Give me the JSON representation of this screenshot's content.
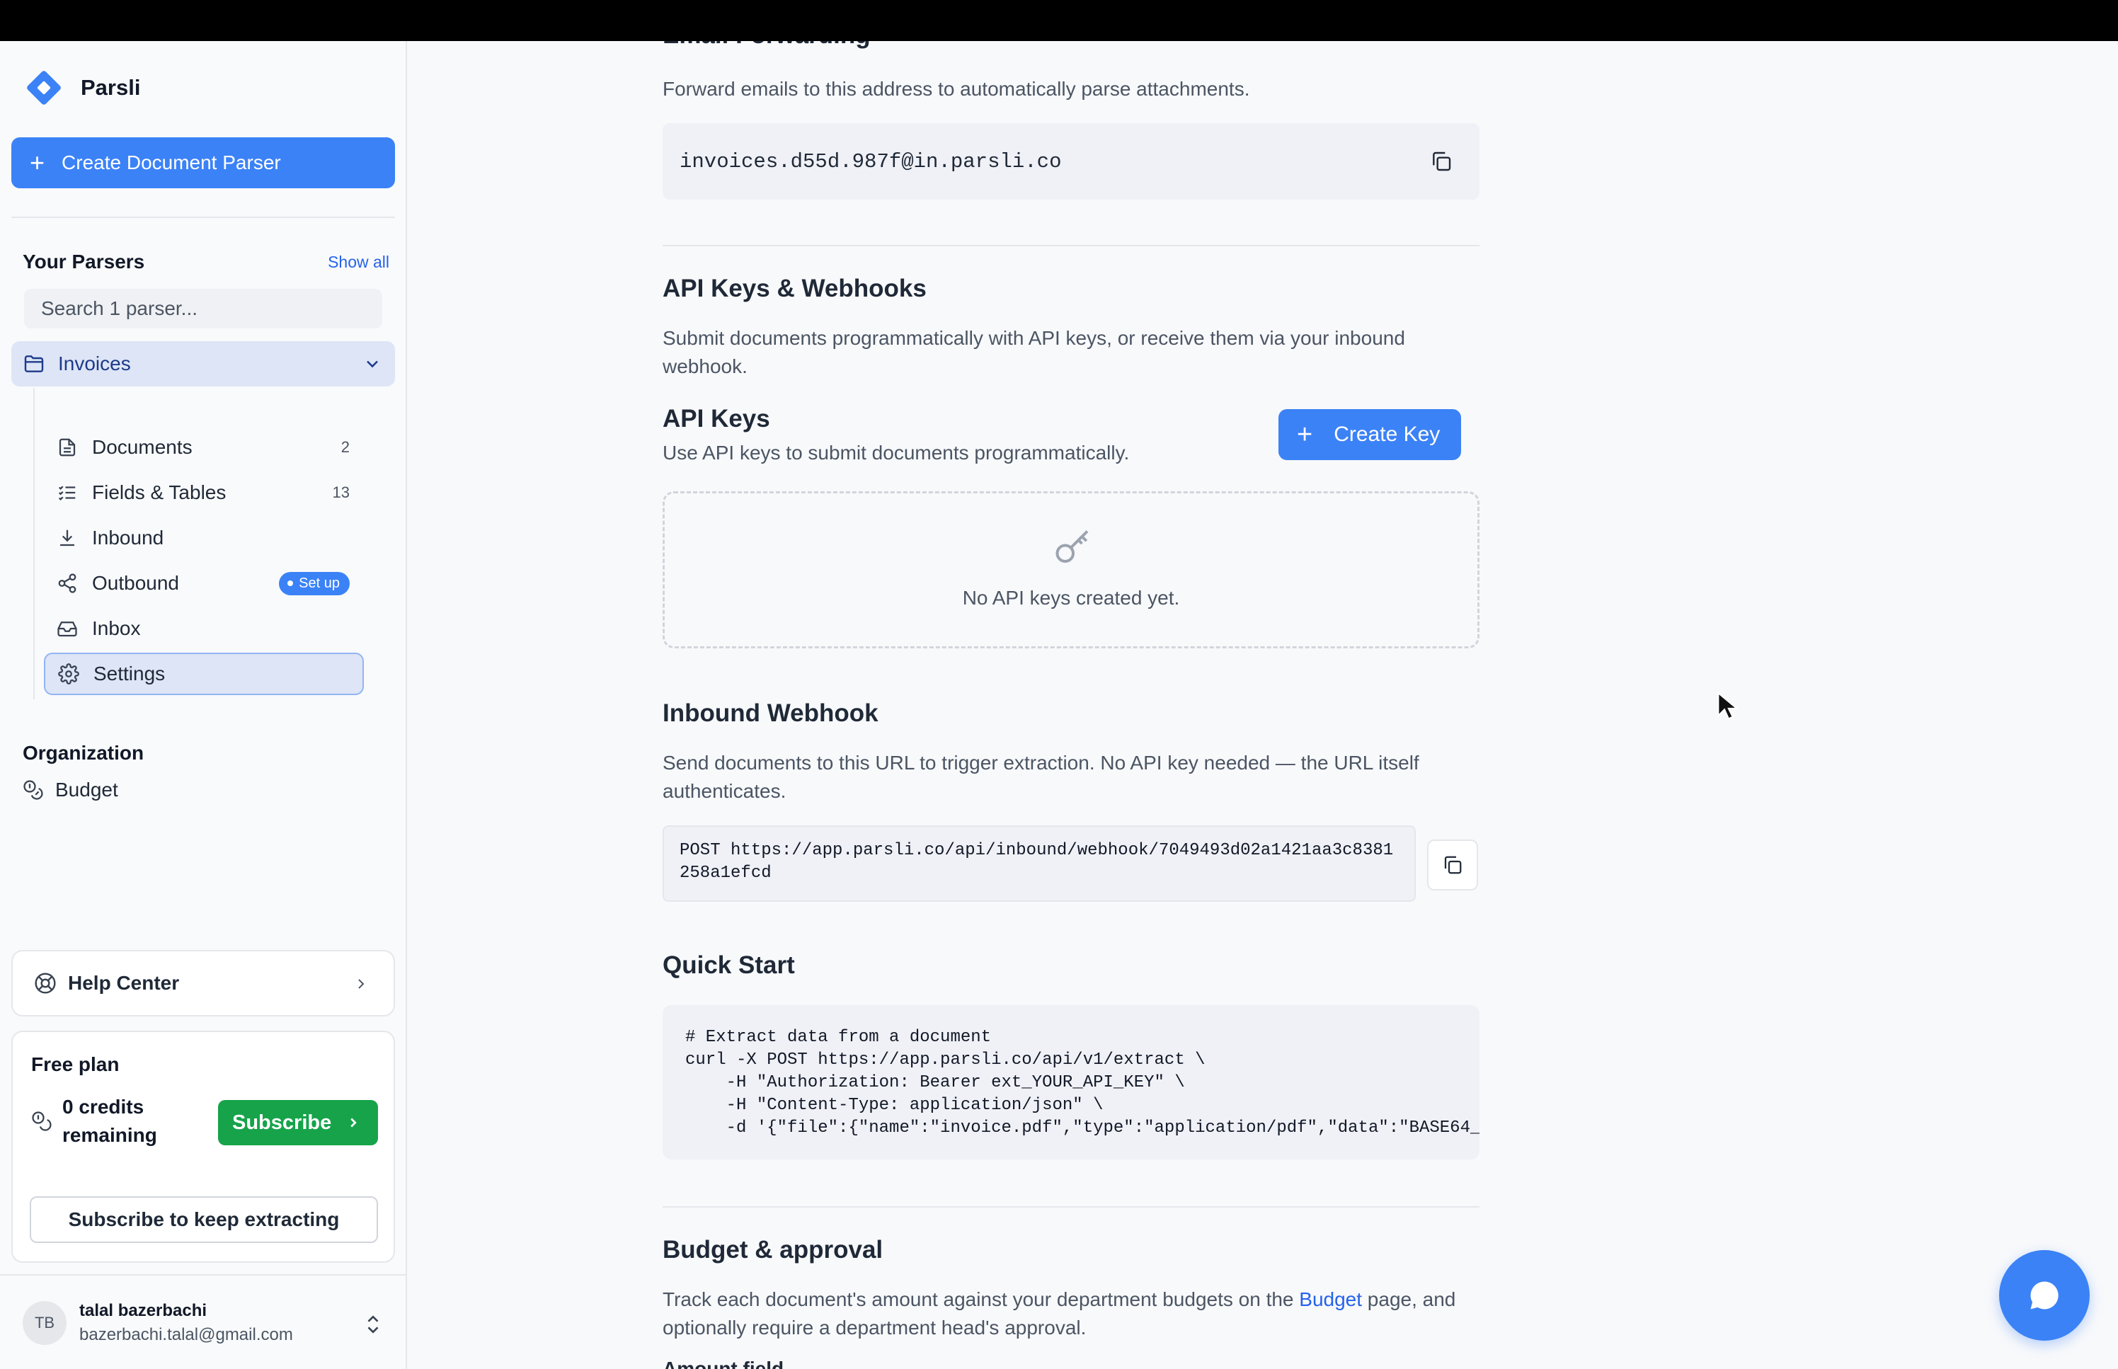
{
  "brand": {
    "name": "Parsli"
  },
  "sidebar": {
    "create_button": "Create Document Parser",
    "parsers_title": "Your Parsers",
    "show_all": "Show all",
    "search_placeholder": "Search 1 parser...",
    "parser": {
      "label": "Invoices"
    },
    "nav": [
      {
        "label": "Documents",
        "count": "2",
        "icon": "document-icon"
      },
      {
        "label": "Fields & Tables",
        "count": "13",
        "icon": "list-check-icon"
      },
      {
        "label": "Inbound",
        "icon": "download-icon"
      },
      {
        "label": "Outbound",
        "badge": "Set up",
        "icon": "share-icon"
      },
      {
        "label": "Inbox",
        "icon": "inbox-icon"
      },
      {
        "label": "Settings",
        "icon": "gear-icon",
        "active": true
      }
    ],
    "org_title": "Organization",
    "budget": "Budget",
    "help_center": "Help Center",
    "plan": {
      "title": "Free plan",
      "credits": "0 credits remaining",
      "subscribe": "Subscribe",
      "keep": "Subscribe to keep extracting"
    },
    "user": {
      "initials": "TB",
      "name": "talal bazerbachi",
      "email": "bazerbachi.talal@gmail.com"
    }
  },
  "main": {
    "email_forwarding": {
      "title": "Email Forwarding",
      "desc": "Forward emails to this address to automatically parse attachments.",
      "address": "invoices.d55d.987f@in.parsli.co"
    },
    "api": {
      "title": "API Keys & Webhooks",
      "desc": "Submit documents programmatically with API keys, or receive them via your inbound webhook.",
      "keys_title": "API Keys",
      "keys_desc": "Use API keys to submit documents programmatically.",
      "create_key": "Create Key",
      "empty": "No API keys created yet."
    },
    "webhook": {
      "title": "Inbound Webhook",
      "desc": "Send documents to this URL to trigger extraction. No API key needed — the URL itself authenticates.",
      "url_line1": "POST https://app.parsli.co/api/inbound/webhook/7049493d02a1421aa3c8381",
      "url_line2": "258a1efcd"
    },
    "quick_start": {
      "title": "Quick Start",
      "code": "# Extract data from a document\ncurl -X POST https://app.parsli.co/api/v1/extract \\\n    -H \"Authorization: Bearer ext_YOUR_API_KEY\" \\\n    -H \"Content-Type: application/json\" \\\n    -d '{\"file\":{\"name\":\"invoice.pdf\",\"type\":\"application/pdf\",\"data\":\"BASE64_"
    },
    "budget": {
      "title": "Budget & approval",
      "desc_before": "Track each document's amount against your department budgets on the ",
      "link": "Budget",
      "desc_after": " page, and optionally require a department head's approval.",
      "amount_label": "Amount field"
    }
  },
  "colors": {
    "accent": "#3b82f6",
    "success": "#16a34a"
  }
}
